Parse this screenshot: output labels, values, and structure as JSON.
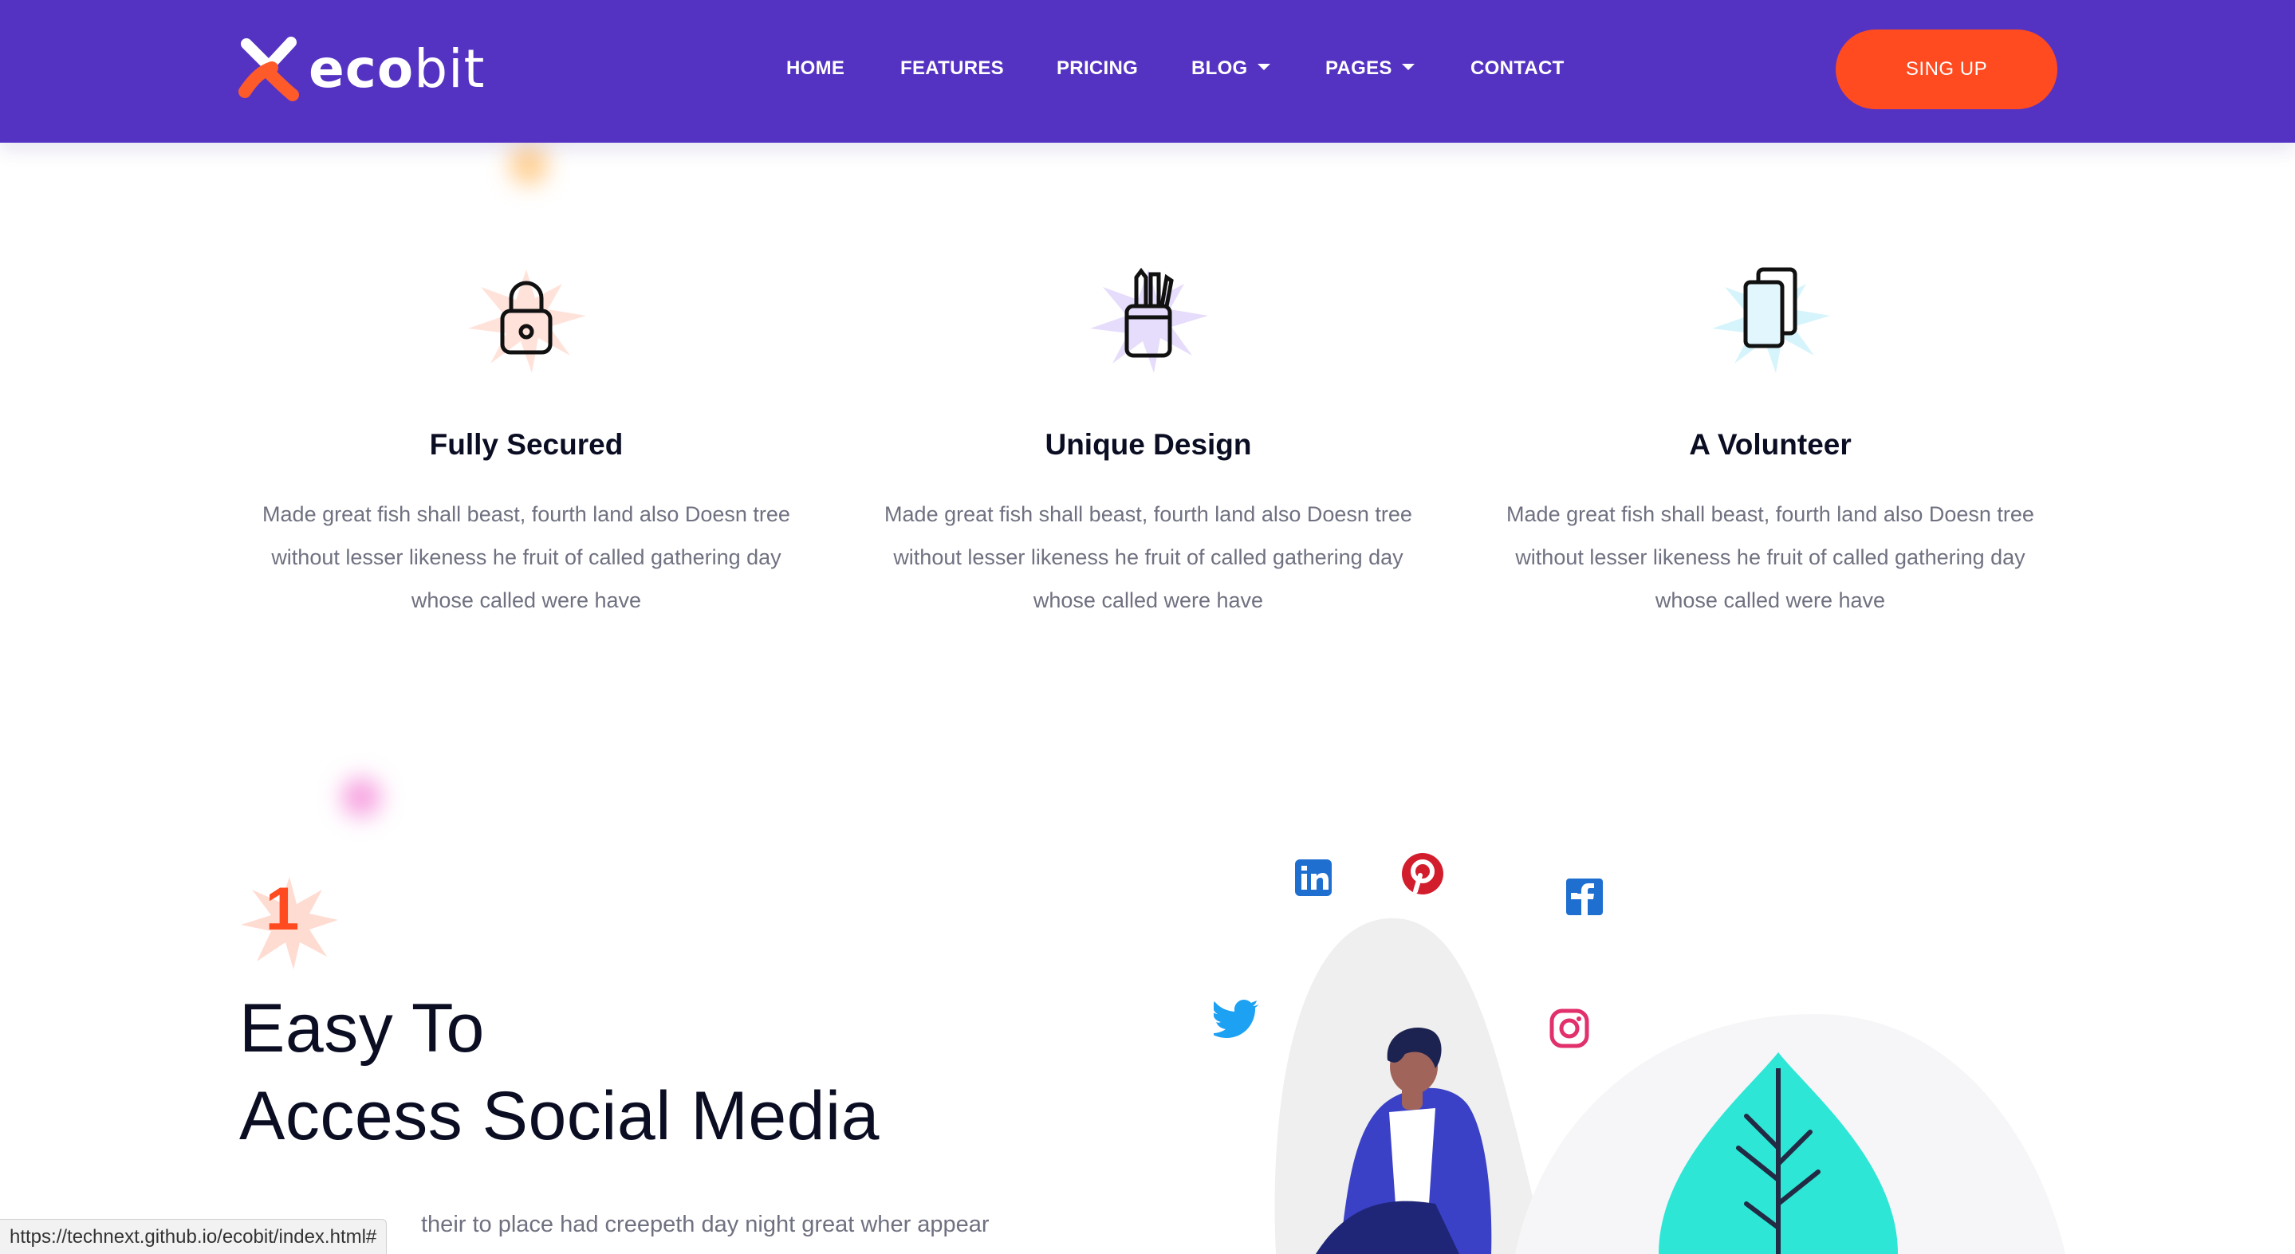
{
  "header": {
    "logo": {
      "text_bold": "eco",
      "text_light": "bit",
      "mark": "x-logo-mark"
    },
    "nav": [
      {
        "label": "HOME",
        "dropdown": false
      },
      {
        "label": "FEATURES",
        "dropdown": false
      },
      {
        "label": "PRICING",
        "dropdown": false
      },
      {
        "label": "BLOG",
        "dropdown": true
      },
      {
        "label": "PAGES",
        "dropdown": true
      },
      {
        "label": "CONTACT",
        "dropdown": false
      }
    ],
    "cta_label": "SING UP"
  },
  "features": [
    {
      "icon": "lock-icon",
      "title": "Fully Secured",
      "lines": [
        "Made great fish shall beast, fourth land also Doesn tree",
        "without lesser likeness he fruit of called gathering day",
        "whose called were have"
      ]
    },
    {
      "icon": "pencil-cup-icon",
      "title": "Unique Design",
      "lines": [
        "Made great fish shall beast, fourth land also Doesn tree",
        "without lesser likeness he fruit of called gathering day",
        "whose called were have"
      ]
    },
    {
      "icon": "copy-pages-icon",
      "title": "A Volunteer",
      "lines": [
        "Made great fish shall beast, fourth land also Doesn tree",
        "without lesser likeness he fruit of called gathering day",
        "whose called were have"
      ]
    }
  ],
  "social_section": {
    "step_number": "1",
    "title_line1": "Easy To",
    "title_line2": "Access Social Media",
    "text": "their to place had creepeth day night great wher appear",
    "icons": [
      "linkedin-icon",
      "pinterest-icon",
      "facebook-icon",
      "twitter-icon",
      "instagram-icon"
    ]
  },
  "status_bar": {
    "url": "https://technext.github.io/ecobit/index.html#"
  },
  "colors": {
    "header_bg": "#5533c2",
    "cta_bg": "#ff4b1f",
    "title": "#0b0e23",
    "body_text": "#6f7180",
    "leaf": "#2ee6d6"
  }
}
